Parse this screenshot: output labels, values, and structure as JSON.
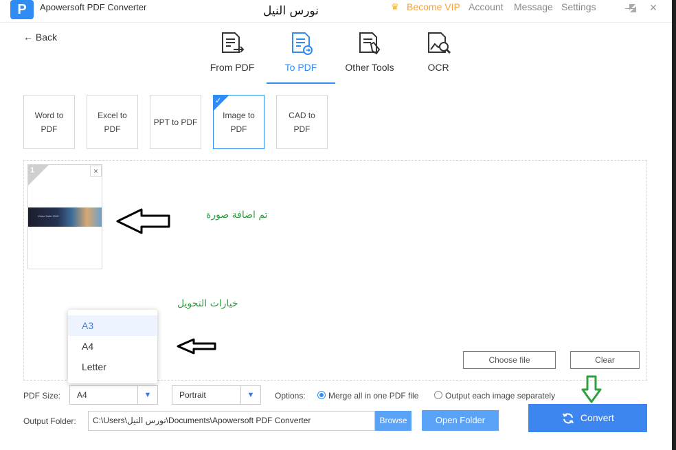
{
  "app": {
    "logo_glyph": "P",
    "title": "Apowersoft PDF Converter",
    "user_name": "نورس النيل"
  },
  "topnav": {
    "vip_label": "Become VIP",
    "account_label": "Account",
    "message_label": "Message",
    "settings_label": "Settings"
  },
  "back_label": "Back",
  "tabs": [
    {
      "label": "From PDF",
      "icon": "from-pdf-icon"
    },
    {
      "label": "To PDF",
      "icon": "to-pdf-icon",
      "active": true
    },
    {
      "label": "Other Tools",
      "icon": "other-tools-icon"
    },
    {
      "label": "OCR",
      "icon": "ocr-icon"
    }
  ],
  "sub_options": [
    {
      "label": "Word to PDF"
    },
    {
      "label": "Excel to PDF"
    },
    {
      "label": "PPT to PDF"
    },
    {
      "label": "Image to PDF",
      "selected": true
    },
    {
      "label": "CAD to PDF"
    }
  ],
  "thumbnail": {
    "number": "1",
    "close": "×",
    "image_caption": "Video Suite 2020"
  },
  "annotations": {
    "image_added": "تم اضافة صورة",
    "conversion_options": "خيارات التحويل"
  },
  "file_buttons": {
    "choose": "Choose file",
    "clear": "Clear"
  },
  "pdf_size": {
    "label": "PDF Size:",
    "value": "A4",
    "options": [
      "A3",
      "A4",
      "Letter"
    ],
    "highlighted": "A3"
  },
  "orientation": {
    "value": "Portrait"
  },
  "options": {
    "label": "Options:",
    "merge_label": "Merge all in one PDF file",
    "separate_label": "Output each image separately"
  },
  "output": {
    "label": "Output Folder:",
    "path": "C:\\Users\\نورس النيل\\Documents\\Apowersoft PDF Converter",
    "browse_label": "Browse",
    "open_folder_label": "Open Folder"
  },
  "convert_label": "Convert",
  "colors": {
    "accent": "#2f8cf5",
    "vip": "#f0a340",
    "annotation": "#2ea040",
    "convert": "#3d86ef"
  }
}
